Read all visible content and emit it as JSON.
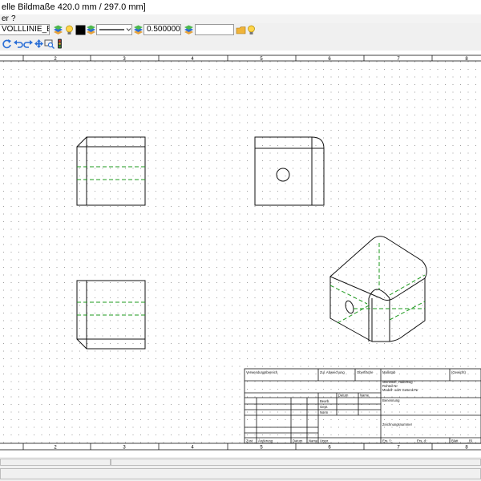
{
  "window": {
    "title": "elle Bildmaße 420.0 mm / 297.0 mm]"
  },
  "menu": {
    "items": [
      "er",
      "?"
    ]
  },
  "toolbar": {
    "line_type": "VOLLLINIE_BREIT",
    "line_width": "0.500000",
    "text_field": "",
    "colors": {
      "accent": "#ffd54a",
      "blue": "#2b6fd6",
      "green": "#2aa52a",
      "red": "#d63a2b"
    }
  },
  "drawing": {
    "ruler_numbers": [
      "2",
      "3",
      "4",
      "5",
      "6",
      "7",
      "8"
    ],
    "colors": {
      "outline": "#111111",
      "hidden": "#1e9a1e",
      "grid": "#9e9e9e"
    }
  },
  "title_block": {
    "fields": [
      "Verwendungsbereich",
      "Zul. Abweichung",
      "Oberfläche",
      "Maßstab",
      "(Gewicht)",
      "Werkstoff, Halbzeug",
      "Rohteil-Nr",
      "Modell- oder Gesenk-Nr",
      "Datum",
      "Name",
      "Bearb.",
      "Gepr.",
      "Norm",
      "Benennung",
      "Zeichnungsnummer",
      "Zust.",
      "Änderung",
      "Datum",
      "Name",
      "Urspr.",
      "Ers. f.:",
      "Ers. d.:",
      "Blatt",
      "Bl."
    ]
  }
}
